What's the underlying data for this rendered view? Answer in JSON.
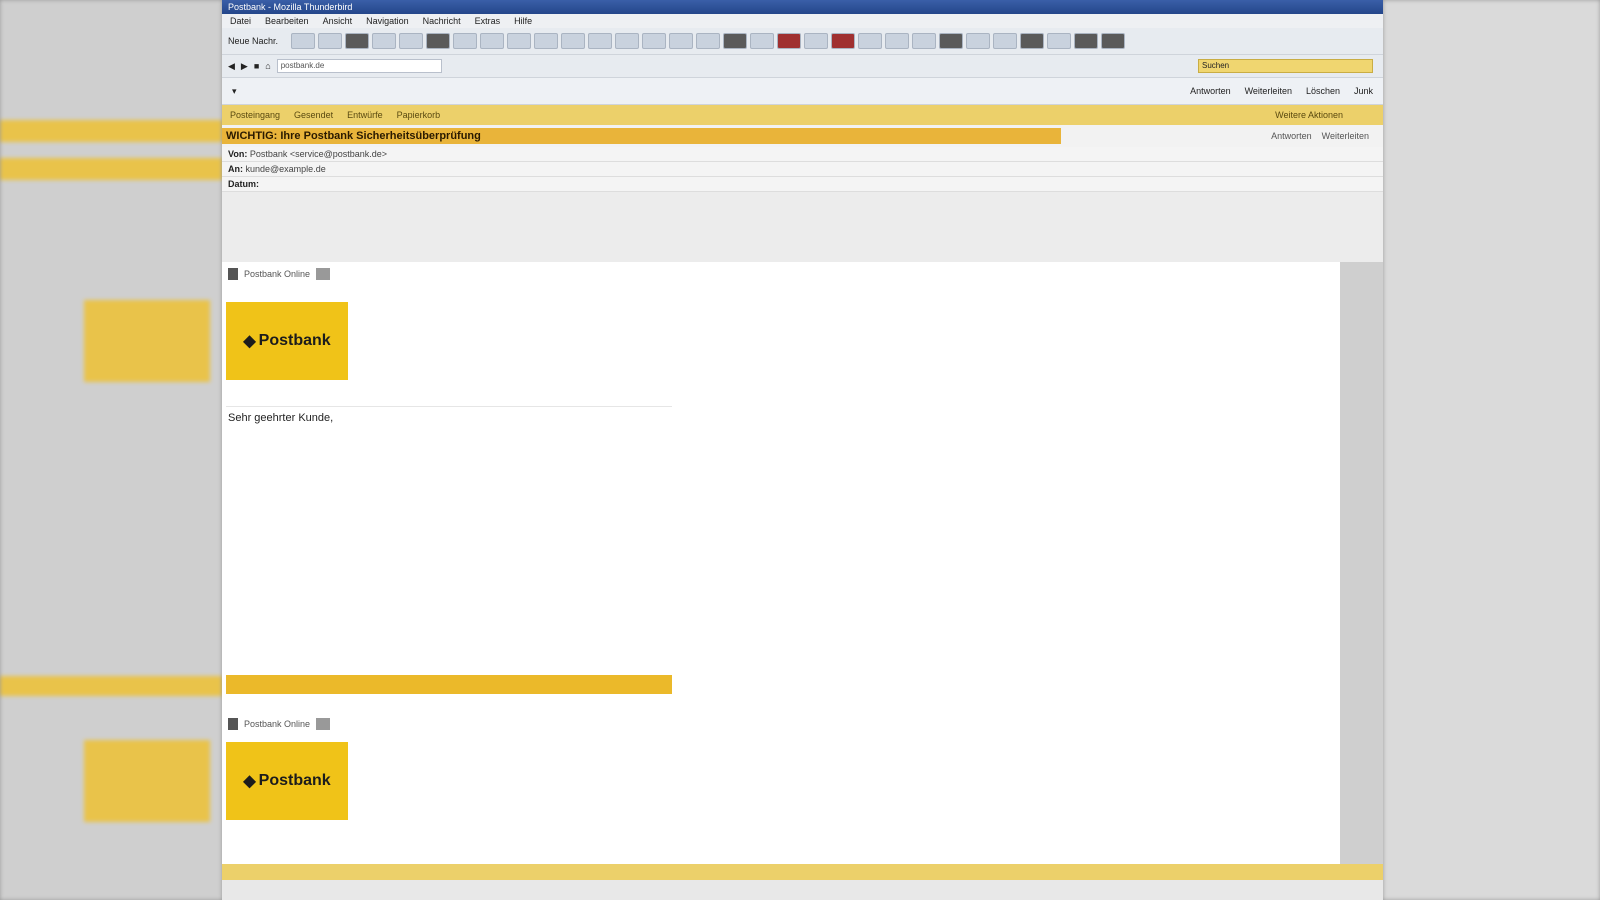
{
  "window": {
    "title": "Postbank - Mozilla Thunderbird"
  },
  "menu": [
    "Datei",
    "Bearbeiten",
    "Ansicht",
    "Navigation",
    "Nachricht",
    "Extras",
    "Hilfe"
  ],
  "toolbar": {
    "new_message": "Neue Nachr."
  },
  "address_bar": {
    "value": "postbank.de"
  },
  "search": {
    "placeholder": "Suchen"
  },
  "actions": {
    "reply": "Antworten",
    "forward": "Weiterleiten",
    "delete": "Löschen",
    "junk": "Junk"
  },
  "nav": {
    "items": [
      "Posteingang",
      "Gesendet",
      "Entwürfe",
      "Papierkorb"
    ],
    "right": "Weitere Aktionen"
  },
  "message": {
    "subject": "WICHTIG: Ihre Postbank Sicherheitsüberprüfung",
    "meta_right": [
      "Antworten",
      "Weiterleiten"
    ],
    "from_label": "Von:",
    "from": "Postbank <service@postbank.de>",
    "to_label": "An:",
    "to": "kunde@example.de",
    "date_label": "Datum:",
    "date": ""
  },
  "body": {
    "sender_line": "Postbank Online",
    "logo_text": "Postbank",
    "greeting": "Sehr geehrter Kunde,",
    "p1_line1": "",
    "p1_line2": "",
    "p2_line1": "",
    "p2_line2": "",
    "p3": "",
    "p4_line1": "",
    "p4_line2": "",
    "p5": "",
    "sign": "",
    "cta": "",
    "second_sender": "Postbank Online",
    "second_logo": "Postbank"
  },
  "status": {
    "left": "",
    "right": ""
  }
}
